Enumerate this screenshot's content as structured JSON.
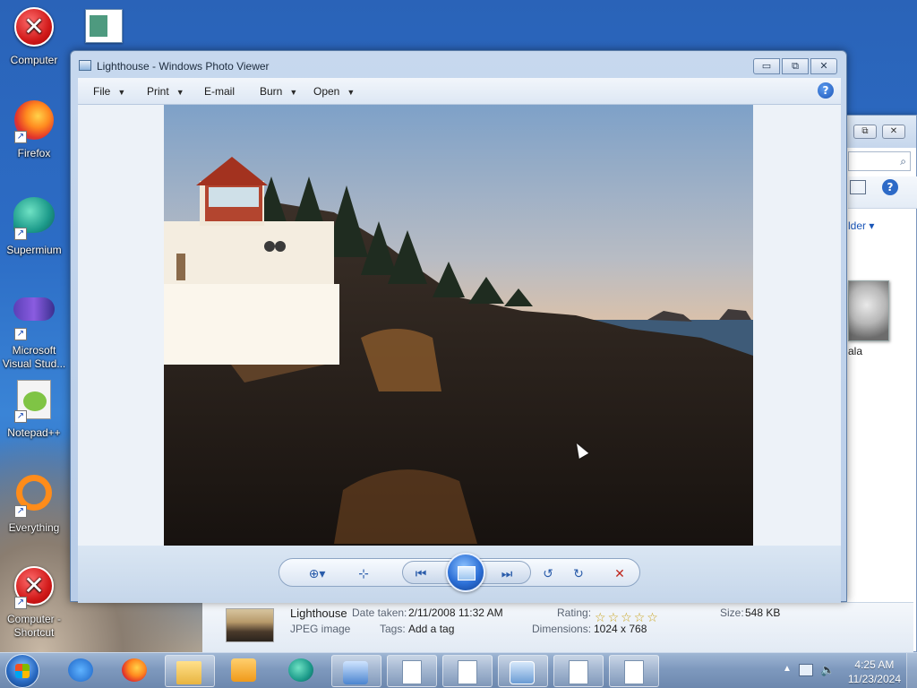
{
  "desktop": {
    "icons": [
      {
        "label": "Computer"
      },
      {
        "label": "Firefox"
      },
      {
        "label": "Supermium"
      },
      {
        "label": "Microsoft Visual Stud..."
      },
      {
        "label": "Notepad++"
      },
      {
        "label": "Everything"
      },
      {
        "label": "Computer - Shortcut"
      }
    ]
  },
  "viewer": {
    "title": "Lighthouse - Windows Photo Viewer",
    "menu": [
      {
        "label": "File",
        "dropdown": true
      },
      {
        "label": "Print",
        "dropdown": true
      },
      {
        "label": "E-mail",
        "dropdown": false
      },
      {
        "label": "Burn",
        "dropdown": true
      },
      {
        "label": "Open",
        "dropdown": true
      }
    ],
    "window_buttons": {
      "minimize": "▭",
      "restore": "⧉",
      "close": "✕"
    },
    "help_glyph": "?"
  },
  "explorer_partial": {
    "folder_label": "lder ▾",
    "thumb_label": "ala"
  },
  "details": {
    "name": "Lighthouse",
    "type": "JPEG image",
    "date_taken_label": "Date taken:",
    "date_taken": "2/11/2008 11:32 AM",
    "tags_label": "Tags:",
    "tags": "Add a tag",
    "rating_label": "Rating:",
    "rating": 0,
    "dimensions_label": "Dimensions:",
    "dimensions": "1024 x 768",
    "size_label": "Size:",
    "size": "548 KB"
  },
  "taskbar": {
    "clock_time": "4:25 AM",
    "clock_date": "11/23/2024"
  }
}
